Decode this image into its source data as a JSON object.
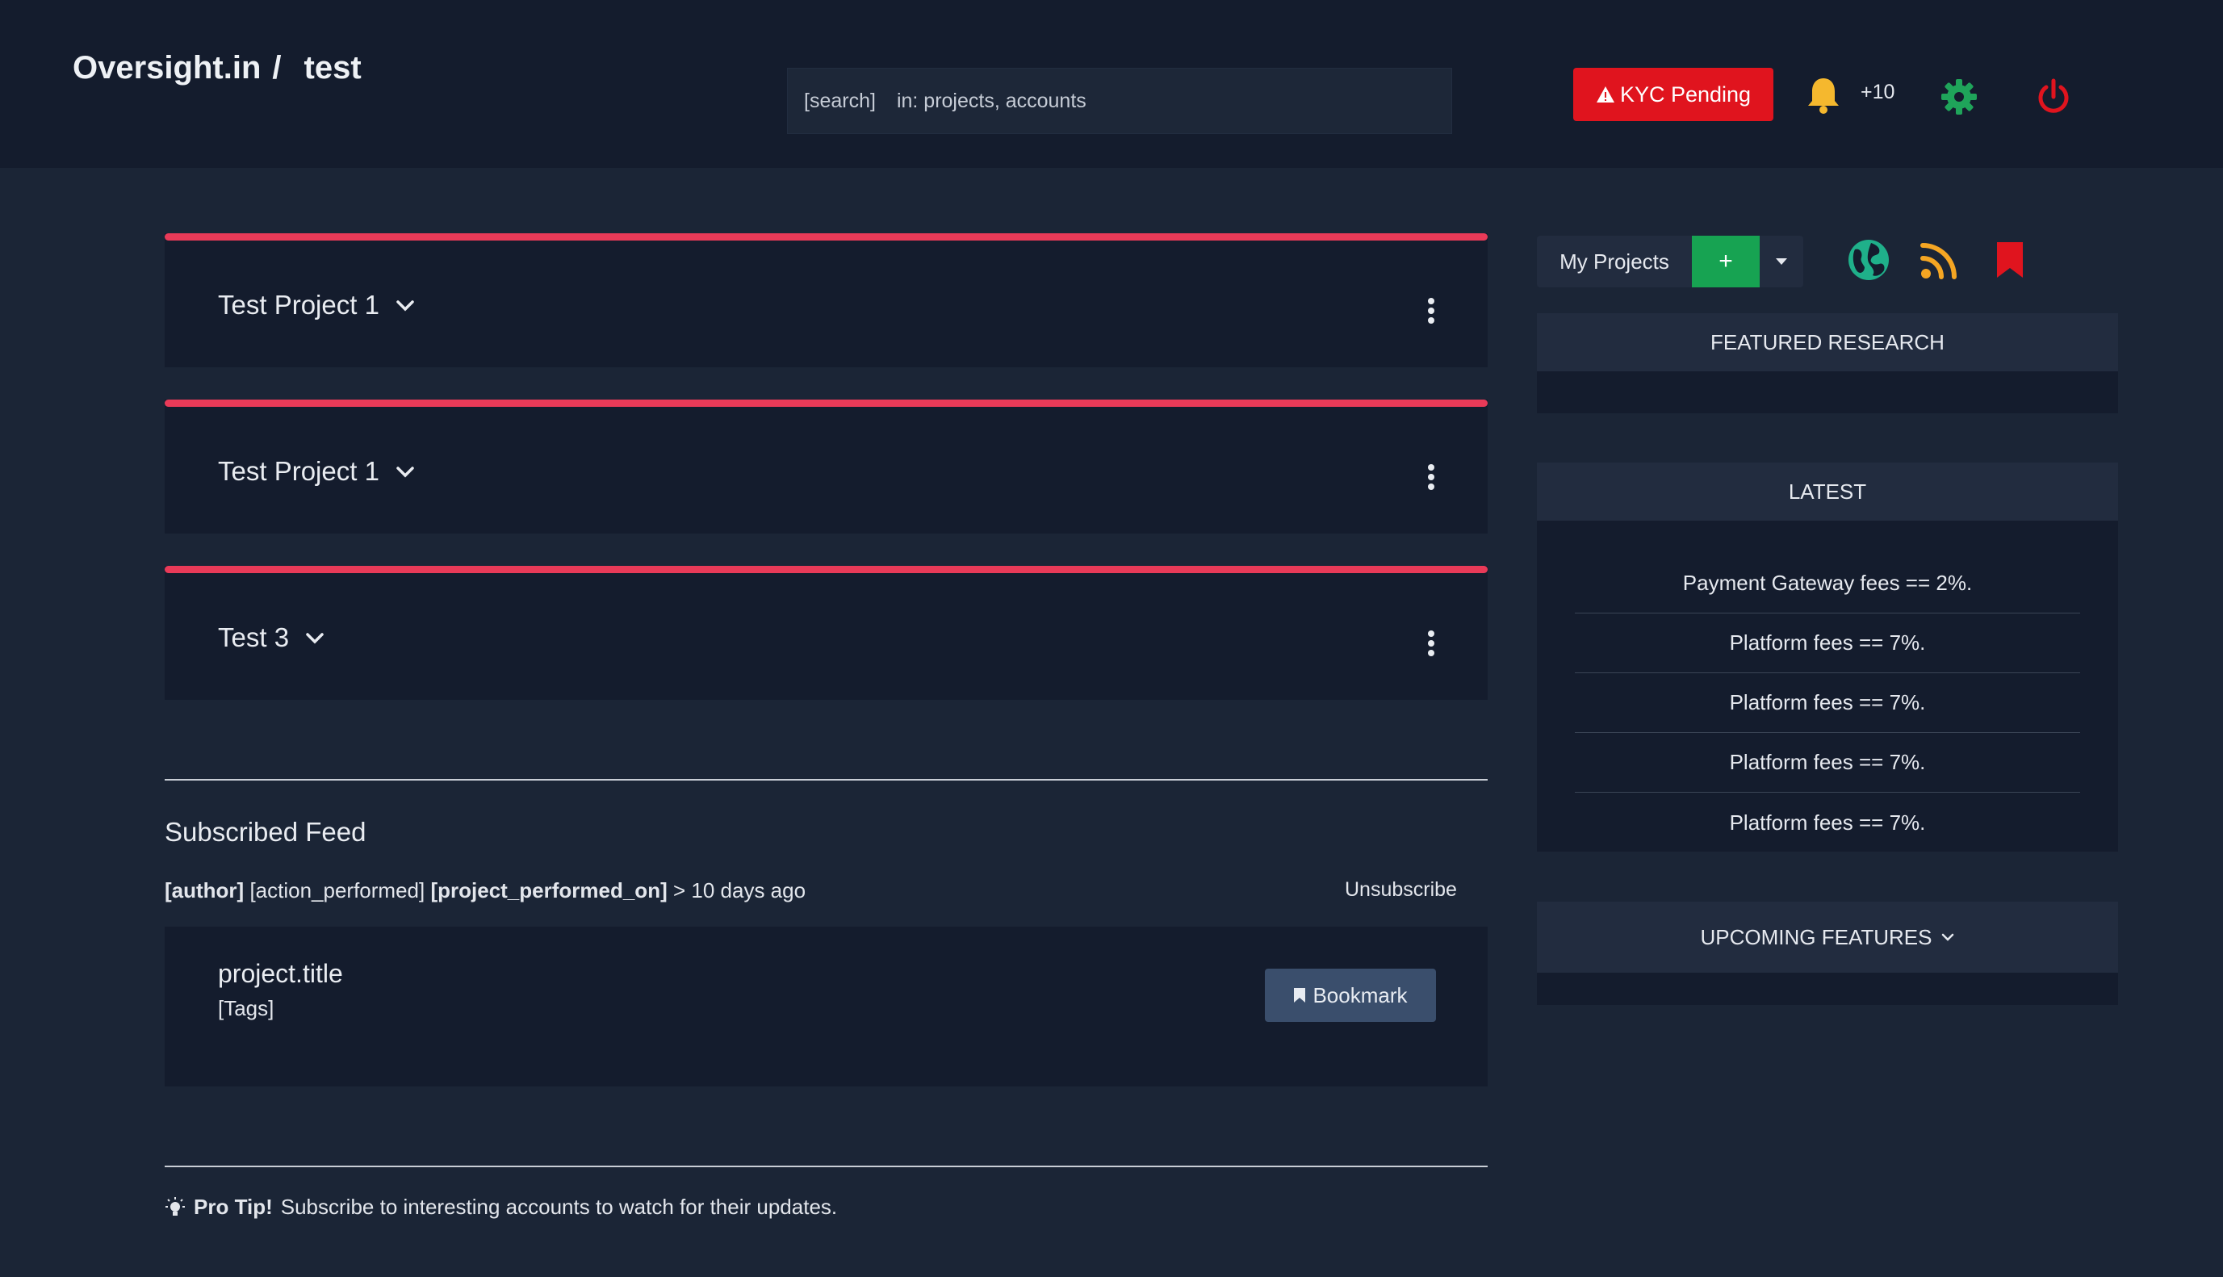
{
  "header": {
    "brand": "Oversight.in",
    "separator": "/",
    "workspace": "test",
    "search_tag": "[search]",
    "search_hint": "in: projects, accounts",
    "kyc_label": "KYC Pending",
    "notification_count": "+10",
    "colors": {
      "kyc": "#e0141e",
      "bell": "#f5b82e",
      "gear": "#1fa45a",
      "power": "#e0141e"
    }
  },
  "projects": [
    {
      "title": "Test Project 1"
    },
    {
      "title": "Test Project 1"
    },
    {
      "title": "Test 3"
    }
  ],
  "feed": {
    "heading": "Subscribed Feed",
    "author": "[author]",
    "action": "[action_performed]",
    "project_performed_on": "[project_performed_on]",
    "time": "> 10 days ago",
    "unsubscribe_label": "Unsubscribe",
    "card": {
      "title": "project.title",
      "tags": "[Tags]",
      "bookmark_label": "Bookmark"
    }
  },
  "protip": {
    "label": "Pro Tip!",
    "text": "Subscribe to interesting accounts to watch for their updates."
  },
  "sidebar": {
    "my_projects_label": "My Projects",
    "add_label": "+",
    "featured_heading": "FEATURED RESEARCH",
    "latest_heading": "LATEST",
    "latest_items": [
      "Payment Gateway fees == 2%.",
      "Platform fees == 7%.",
      "Platform fees == 7%.",
      "Platform fees == 7%.",
      "Platform fees == 7%."
    ],
    "upcoming_heading": "UPCOMING FEATURES",
    "colors": {
      "add": "#17a352",
      "globe": "#1fb08a",
      "rss": "#f5a623",
      "bookmark": "#e0141e"
    }
  }
}
